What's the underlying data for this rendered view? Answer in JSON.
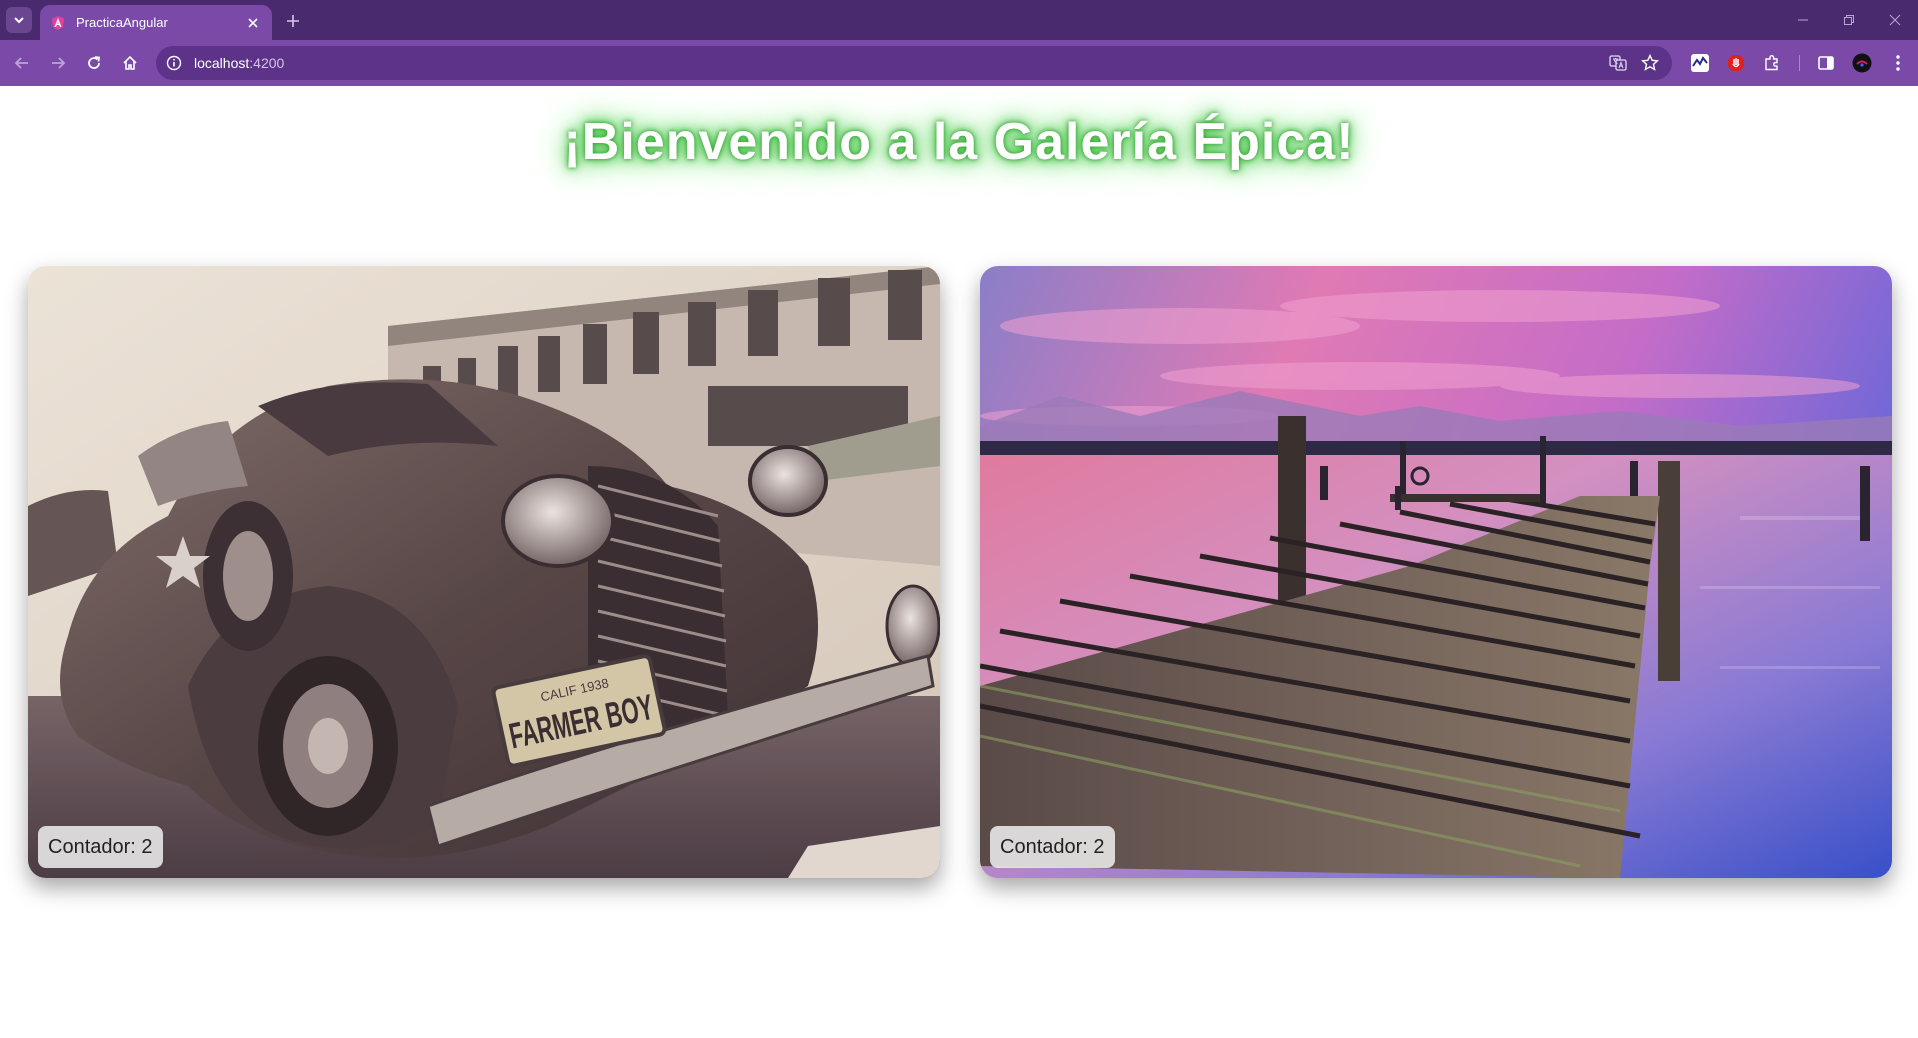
{
  "browser": {
    "tab_title": "PracticaAngular",
    "url_host": "localhost",
    "url_port": ":4200",
    "accent_color": "#7b4aa8",
    "tabbar_color": "#4a2a6e"
  },
  "page": {
    "headline": "¡Bienvenido a la Galería Épica!",
    "headline_glow_color": "#3fbf3f"
  },
  "gallery": {
    "cards": [
      {
        "subject": "vintage-car",
        "plate_line1": "CALIF 1938",
        "plate_line2": "FARMER BOY",
        "counter_label": "Contador: 2"
      },
      {
        "subject": "pier-sunset",
        "counter_label": "Contador: 2"
      }
    ]
  }
}
